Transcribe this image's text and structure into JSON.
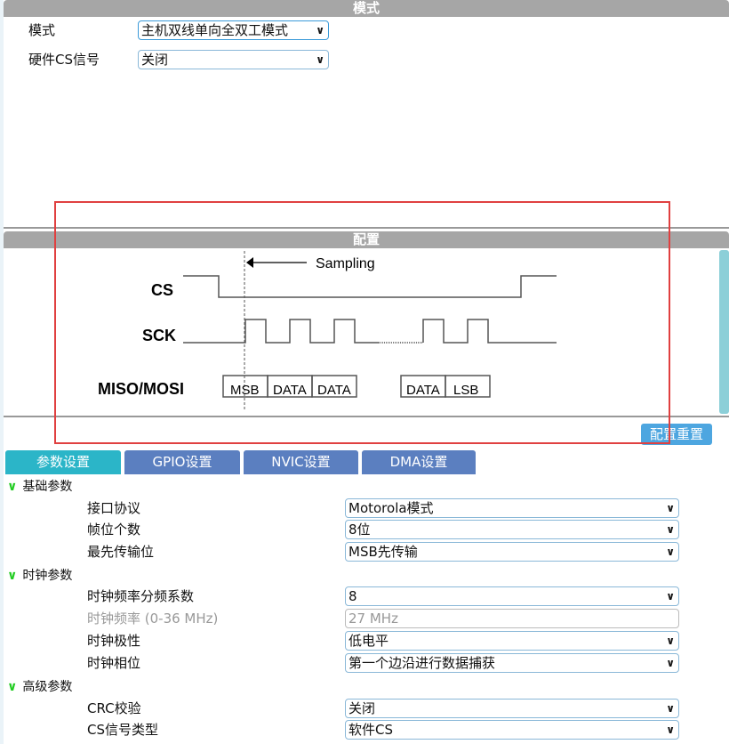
{
  "mode_panel": {
    "title": "模式",
    "mode_label": "模式",
    "mode_value": "主机双线单向全双工模式",
    "hwcs_label": "硬件CS信号",
    "hwcs_value": "关闭"
  },
  "config_panel": {
    "title": "配置",
    "reset_button": "配置重置"
  },
  "diagram": {
    "sampling": "Sampling",
    "cs": "CS",
    "sck": "SCK",
    "miso_mosi": "MISO/MOSI",
    "bits": [
      "MSB",
      "DATA",
      "DATA",
      "DATA",
      "LSB"
    ]
  },
  "tabs": [
    "参数设置",
    "GPIO设置",
    "NVIC设置",
    "DMA设置"
  ],
  "sections": {
    "basic": {
      "title": "基础参数",
      "rows": [
        {
          "label": "接口协议",
          "value": "Motorola模式"
        },
        {
          "label": "帧位个数",
          "value": "8位"
        },
        {
          "label": "最先传输位",
          "value": "MSB先传输"
        }
      ]
    },
    "clock": {
      "title": "时钟参数",
      "rows": [
        {
          "label": "时钟频率分频系数",
          "value": "8"
        },
        {
          "label": "时钟频率 (0-36 MHz)",
          "value": "27 MHz"
        },
        {
          "label": "时钟极性",
          "value": "低电平"
        },
        {
          "label": "时钟相位",
          "value": "第一个边沿进行数据捕获"
        }
      ]
    },
    "advanced": {
      "title": "高级参数",
      "rows": [
        {
          "label": "CRC校验",
          "value": "关闭"
        },
        {
          "label": "CS信号类型",
          "value": "软件CS"
        }
      ]
    }
  },
  "colors": {
    "highlight": "#e04040",
    "active_tab": "#2bb5c8",
    "tab": "#5b7fc0",
    "reset": "#4da6e0"
  }
}
